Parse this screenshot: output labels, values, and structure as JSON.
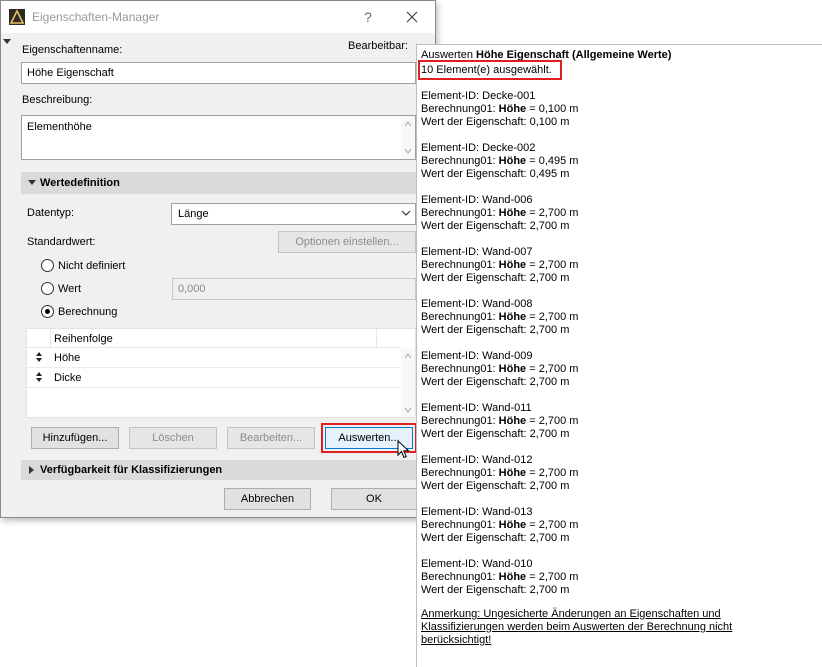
{
  "dialog": {
    "title": "Eigenschaften-Manager",
    "help": "?",
    "property_name_label": "Eigenschaftenname:",
    "editable_label": "Bearbeitbar:",
    "property_name_value": "Höhe Eigenschaft",
    "description_label": "Beschreibung:",
    "description_value": "Elementhöhe",
    "value_def_section": "Wertedefinition",
    "datatype_label": "Datentyp:",
    "datatype_value": "Länge",
    "default_label": "Standardwert:",
    "options_button": "Optionen einstellen...",
    "radio_undefined": "Nicht definiert",
    "radio_value": "Wert",
    "value_field": "0,000",
    "radio_calc": "Berechnung",
    "order_header": "Reihenfolge",
    "order_items": [
      "Höhe",
      "Dicke"
    ],
    "add_button": "Hinzufügen...",
    "delete_button": "Löschen",
    "edit_button": "Bearbeiten...",
    "evaluate_button": "Auswerten...",
    "availability_section": "Verfügbarkeit für Klassifizierungen",
    "cancel_button": "Abbrechen",
    "ok_button": "OK"
  },
  "result": {
    "title_prefix": "Auswerten ",
    "title_bold": "Höhe Eigenschaft (Allgemeine Werte)",
    "selected": "10 Element(e) ausgewählt.",
    "id_prefix": "Element-ID: ",
    "calc_prefix": "Berechnung01: ",
    "calc_var": "Höhe",
    "calc_eq": " = ",
    "value_prefix": "Wert der Eigenschaft: ",
    "elements": [
      {
        "id": "Decke-001",
        "calc": "0,100 m",
        "value": "0,100 m"
      },
      {
        "id": "Decke-002",
        "calc": "0,495 m",
        "value": "0,495 m"
      },
      {
        "id": "Wand-006",
        "calc": "2,700 m",
        "value": "2,700 m"
      },
      {
        "id": "Wand-007",
        "calc": "2,700 m",
        "value": "2,700 m"
      },
      {
        "id": "Wand-008",
        "calc": "2,700 m",
        "value": "2,700 m"
      },
      {
        "id": "Wand-009",
        "calc": "2,700 m",
        "value": "2,700 m"
      },
      {
        "id": "Wand-011",
        "calc": "2,700 m",
        "value": "2,700 m"
      },
      {
        "id": "Wand-012",
        "calc": "2,700 m",
        "value": "2,700 m"
      },
      {
        "id": "Wand-013",
        "calc": "2,700 m",
        "value": "2,700 m"
      },
      {
        "id": "Wand-010",
        "calc": "2,700 m",
        "value": "2,700 m"
      }
    ],
    "note_lines": [
      "Anmerkung: Ungesicherte Änderungen an Eigenschaften und",
      "Klassifizierungen werden beim Auswerten der Berechnung nicht",
      "berücksichtigt!"
    ]
  },
  "colors": {
    "highlight": "#e02020",
    "focus": "#0078d7"
  }
}
